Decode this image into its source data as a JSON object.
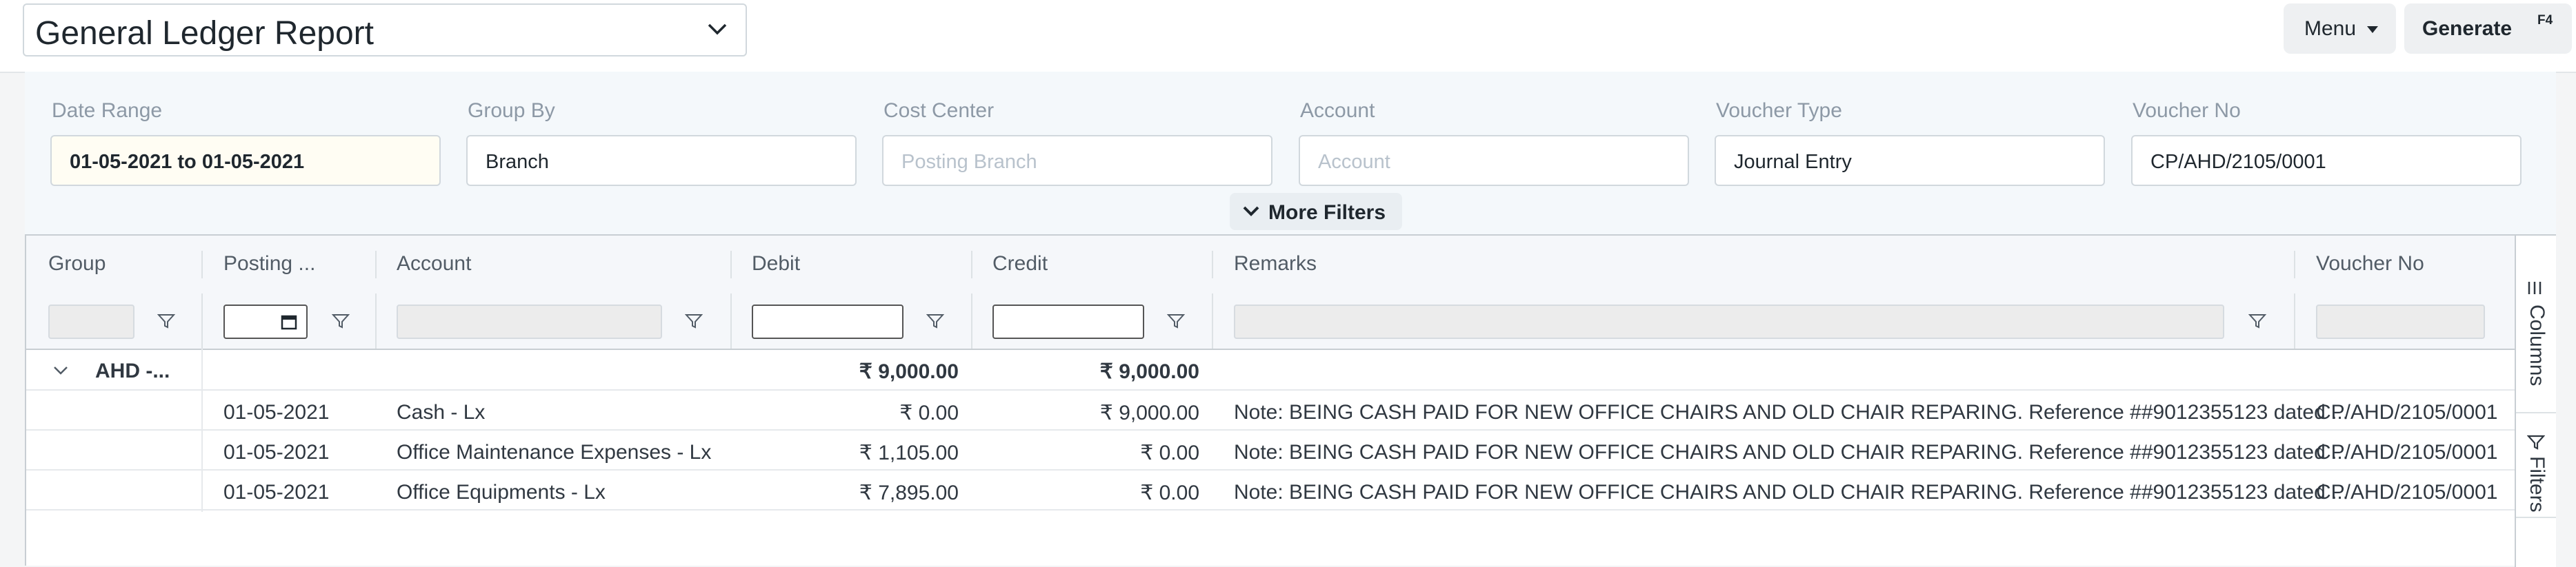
{
  "header": {
    "report_title": "General Ledger Report",
    "menu_label": "Menu",
    "generate_label": "Generate",
    "generate_shortcut": "F4"
  },
  "filters": [
    {
      "label": "Date Range",
      "value": "01-05-2021 to 01-05-2021",
      "placeholder": ""
    },
    {
      "label": "Group By",
      "value": "Branch",
      "placeholder": ""
    },
    {
      "label": "Cost Center",
      "value": "",
      "placeholder": "Posting Branch"
    },
    {
      "label": "Account",
      "value": "",
      "placeholder": "Account"
    },
    {
      "label": "Voucher Type",
      "value": "Journal Entry",
      "placeholder": ""
    },
    {
      "label": "Voucher No",
      "value": "CP/AHD/2105/0001",
      "placeholder": ""
    }
  ],
  "more_filters_label": "More Filters",
  "grid": {
    "columns": [
      "Group",
      "Posting ...",
      "Account",
      "Debit",
      "Credit",
      "Remarks",
      "Voucher No"
    ],
    "group_row": {
      "group": "AHD -...",
      "debit": "₹ 9,000.00",
      "credit": "₹ 9,000.00"
    },
    "rows": [
      {
        "posting_date": "01-05-2021",
        "account": "Cash - Lx",
        "debit": "₹ 0.00",
        "credit": "₹ 9,000.00",
        "remarks": "Note: BEING CASH PAID FOR NEW OFFICE CHAIRS AND OLD CHAIR REPARING. Reference ##9012355123 dated ...",
        "voucher_no": "CP/AHD/2105/0001"
      },
      {
        "posting_date": "01-05-2021",
        "account": "Office Maintenance Expenses - Lx",
        "debit": "₹ 1,105.00",
        "credit": "₹ 0.00",
        "remarks": "Note: BEING CASH PAID FOR NEW OFFICE CHAIRS AND OLD CHAIR REPARING. Reference ##9012355123 dated ...",
        "voucher_no": "CP/AHD/2105/0001"
      },
      {
        "posting_date": "01-05-2021",
        "account": "Office Equipments - Lx",
        "debit": "₹ 7,895.00",
        "credit": "₹ 0.00",
        "remarks": "Note: BEING CASH PAID FOR NEW OFFICE CHAIRS AND OLD CHAIR REPARING. Reference ##9012355123 dated ...",
        "voucher_no": "CP/AHD/2105/0001"
      }
    ]
  },
  "side_panel": {
    "columns_label": "Columns",
    "filters_label": "Filters"
  },
  "icons": {
    "report_select": "chevron-down-icon",
    "more_filters": "chevron-down-icon",
    "column_filter": "funnel-icon",
    "date_picker": "calendar-icon",
    "group_toggle": "chevron-down-icon",
    "columns_tab": "columns-icon",
    "filters_tab": "funnel-icon"
  }
}
